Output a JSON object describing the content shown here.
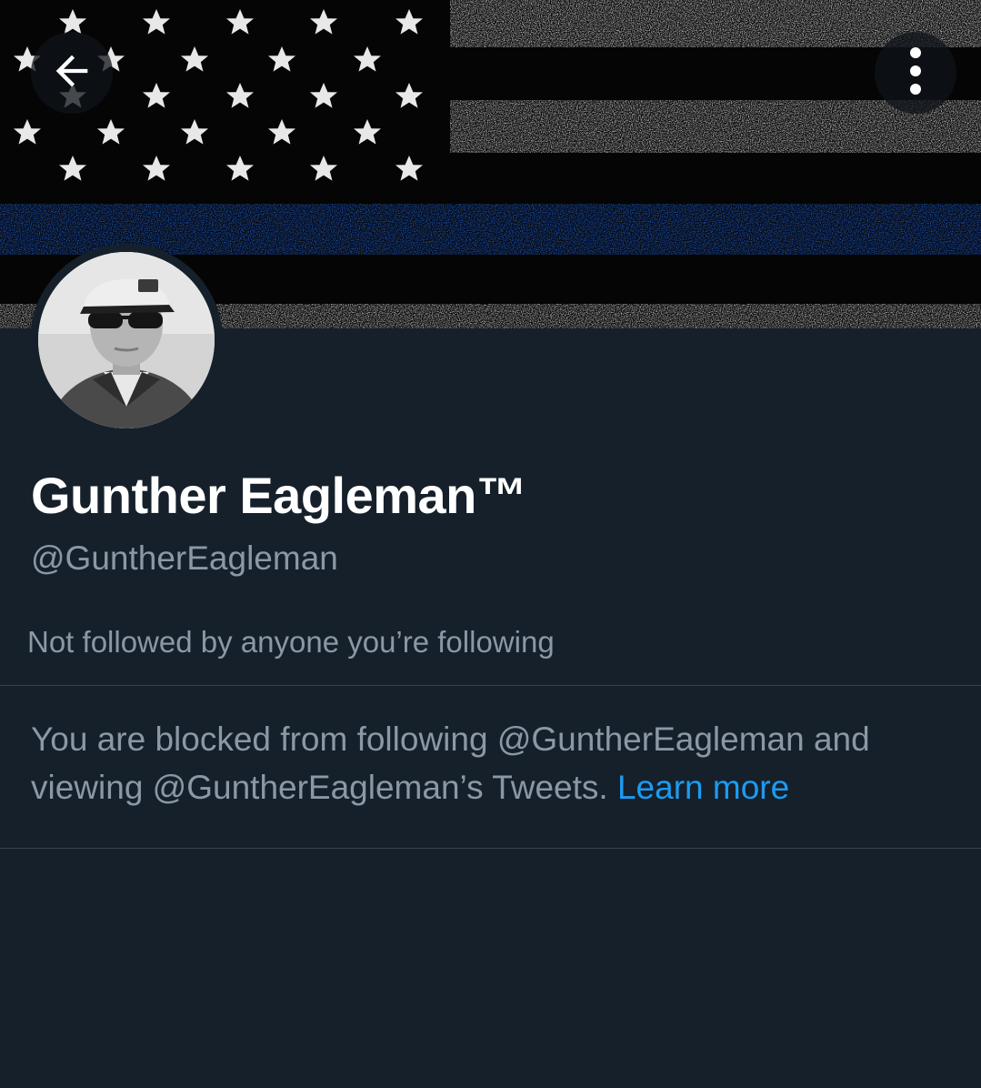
{
  "profile": {
    "display_name": "Gunther Eagleman™",
    "handle": "@GuntherEagleman",
    "followers_context": "Not followed by anyone you’re following"
  },
  "blocked_notice": {
    "message": "You are blocked from following @GuntherEagleman and viewing @GuntherEagleman’s Tweets.",
    "learn_more_label": "Learn more"
  },
  "icons": {
    "back": "arrow-left-icon",
    "more": "more-vertical-icon"
  },
  "colors": {
    "background": "#15202b",
    "primary_text": "#ffffff",
    "secondary_text": "#8b98a5",
    "link": "#1d9bf0",
    "divider": "#38444d",
    "banner_blue_line": "#1f5fd6"
  }
}
